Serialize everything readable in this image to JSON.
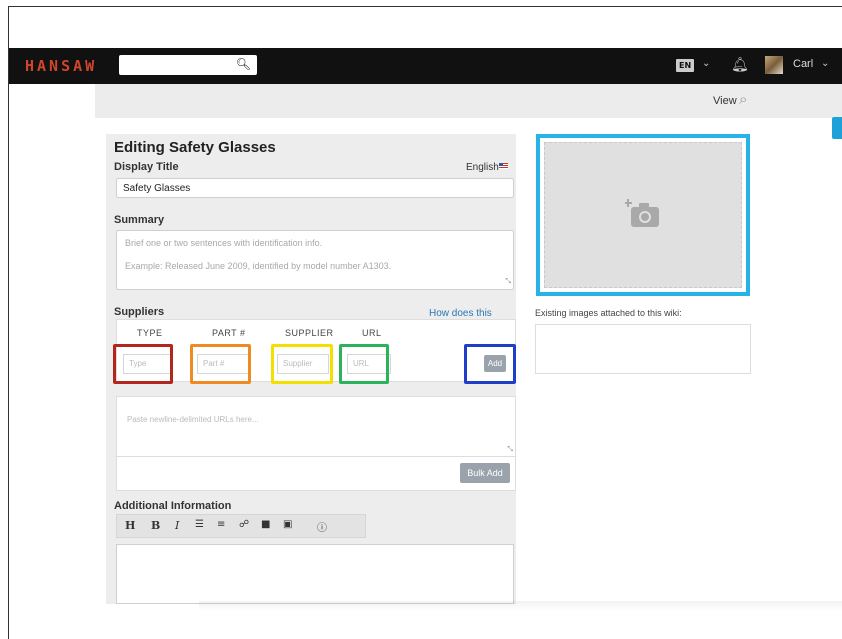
{
  "brand": {
    "logo_text": "HANSAW"
  },
  "topbar": {
    "language_badge": "EN",
    "user_name": "Carl",
    "icons": [
      "search-icon",
      "chevron-down-icon",
      "bell-icon",
      "avatar"
    ]
  },
  "subheader": {
    "view_label": "View"
  },
  "form": {
    "page_title": "Editing Safety Glasses",
    "display_title_label": "Display Title",
    "language_label": "English",
    "display_title_value": "Safety Glasses",
    "summary_label": "Summary",
    "summary_placeholder_line1": "Brief one or two sentences with identification info.",
    "summary_placeholder_line2": "Example: Released June 2009, identified by model number A1303.",
    "suppliers_label": "Suppliers",
    "how_link": "How does this work?",
    "columns": [
      "TYPE",
      "PART #",
      "SUPPLIER",
      "URL"
    ],
    "placeholders": {
      "type": "Type",
      "part": "Part #",
      "supplier": "Supplier",
      "url": "URL"
    },
    "add_button": "Add",
    "bulk_placeholder": "Paste newline-delimited URLs here...",
    "bulk_add_button": "Bulk Add",
    "additional_info_label": "Additional Information",
    "toolbar": [
      "H",
      "B",
      "I"
    ]
  },
  "sidebar": {
    "existing_images_label": "Existing images attached to this wiki:"
  },
  "colors": {
    "highlight_type": "#b3261e",
    "highlight_part": "#f08a24",
    "highlight_supplier": "#f3e000",
    "highlight_url": "#2ab35a",
    "highlight_add": "#1f3fc8",
    "highlight_image": "#28b3e6",
    "brand": "#d0452c"
  }
}
